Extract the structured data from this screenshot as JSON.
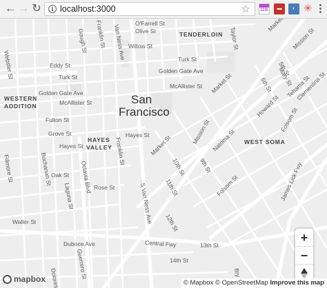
{
  "browser": {
    "url": "localhost:3000",
    "calendar_day": "11th"
  },
  "map": {
    "city": [
      "San",
      "Francisco"
    ],
    "districts": {
      "tenderloin": "TENDERLOIN",
      "western_addition": [
        "WESTERN",
        "ADDITION"
      ],
      "hayes_valley": [
        "HAYES",
        "VALLEY"
      ],
      "west_soma": "WEST SOMA"
    },
    "streets": {
      "ofarrell": "O'Farrell St",
      "olive": "Olive St",
      "willow": "Willow St",
      "turk_e": "Turk St",
      "turk_w": "Turk St",
      "eddy": "Eddy St",
      "golden_gate_e": "Golden Gate Ave",
      "golden_gate_w": "Golden Gate Ave",
      "mcallister_e": "McAllister St",
      "mcallister_w": "McAllister St",
      "fulton": "Fulton St",
      "grove": "Grove St",
      "hayes_w": "Hayes St",
      "hayes_e": "Hayes St",
      "oak": "Oak St",
      "rose": "Rose St",
      "waller": "Waller St",
      "duboce": "Duboce Ave",
      "central_fwy": "Central Fwy",
      "13th": "13th St",
      "14th": "14th St",
      "12th": "12th St",
      "11th": "11th St",
      "10th": "10th St",
      "9th": "9th St",
      "market_ne": "Market St",
      "market_mid": "Market St",
      "market_sw": "Market St",
      "mission_ne": "Mission St",
      "mission_mid": "Mission St",
      "natoma": "Natoma St",
      "howard": "Howard St",
      "folsom_e": "Folsom St",
      "folsom_mid": "Folsom St",
      "5th": "5th St",
      "6th": "6th St",
      "mary": "Mary St",
      "tehama": "Tehama St",
      "clementina": "Clementina St",
      "james_lick": "James Lick Fwy",
      "taylor": "Taylor St",
      "gough": "Gough St",
      "franklin_n": "Franklin St",
      "franklin_s": "Franklin St",
      "van_ness_n": "Van Ness Ave",
      "van_ness_s": "S Van Ness Ave",
      "webster": "Webster St",
      "fillmore": "Fillmore St",
      "buchanan": "Buchanan St",
      "laguna": "Laguna St",
      "octavia": "Octavia Blvd",
      "guerrero": "Guerrero St",
      "dolores": "Dolores St",
      "bryant": "Bry"
    },
    "controls": {
      "zoom_in": "+",
      "zoom_out": "−"
    },
    "logo": "mapbox",
    "attribution": {
      "mapbox": "© Mapbox",
      "osm": "© OpenStreetMap",
      "improve": "Improve this map"
    }
  }
}
